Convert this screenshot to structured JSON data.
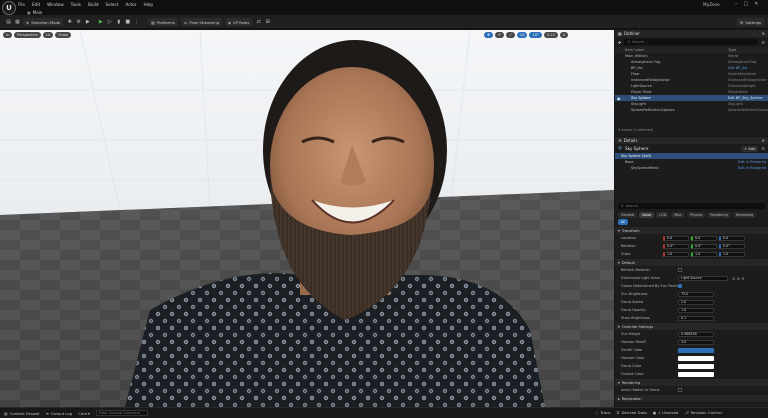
{
  "app": {
    "logo": "U",
    "project_tab": "Main",
    "window_title": "MyZone"
  },
  "menu": [
    "File",
    "Edit",
    "Window",
    "Tools",
    "Build",
    "Select",
    "Actor",
    "Help"
  ],
  "toolbar": {
    "save_icon": "save-icon",
    "mode_label": "Selection Mode",
    "platforms_label": "Platforms",
    "pixel_streaming_label": "Pixel Streaming",
    "vp_rules_label": "VP Roles",
    "settings_label": "Settings"
  },
  "viewport": {
    "perspective_label": "Perspective",
    "lit_label": "Lit",
    "show_label": "Show",
    "snap_value_1": "10",
    "snap_value_2": "10°",
    "snap_value_3": "0.25",
    "camera_speed": "4"
  },
  "outliner": {
    "title": "Outliner",
    "search_placeholder": "Search...",
    "col_label": "Item Label",
    "col_type": "Type",
    "rows": [
      {
        "name": "Main (Editor)",
        "type": "World"
      },
      {
        "name": "Atmospheric Fog",
        "type": "AtmosphericFog"
      },
      {
        "name": "BP_Avi",
        "type": "Edit BP_Avi"
      },
      {
        "name": "Floor",
        "type": "StaticMeshActor"
      },
      {
        "name": "InstancedFoliageActor",
        "type": "InstancedFoliageActor"
      },
      {
        "name": "LightSource",
        "type": "DirectionalLight"
      },
      {
        "name": "Player Start",
        "type": "PlayerStart"
      },
      {
        "name": "Sky Sphere",
        "type": "Edit BP_Sky_Sphere"
      },
      {
        "name": "SkyLight",
        "type": "SkyLight"
      },
      {
        "name": "SphereReflectionCapture",
        "type": "SphereReflectionCapture"
      }
    ],
    "count_text": "9 actors (1 selected)"
  },
  "details": {
    "title": "Details",
    "actor_name": "Sky Sphere",
    "add_label": "+ Add",
    "components": [
      {
        "name": "Sky Sphere (Self)",
        "link": ""
      },
      {
        "name": "Base",
        "link": "Edit in Blueprint"
      },
      {
        "name": "SkySphereMesh",
        "link": "Edit in Blueprint"
      }
    ],
    "search_placeholder": "Search",
    "tabs": [
      "General",
      "Actor",
      "LOD",
      "Misc",
      "Physics",
      "Rendering",
      "Streaming",
      "All"
    ],
    "transform": {
      "title": "Transform",
      "rows": [
        {
          "label": "Location",
          "x": "0.0",
          "y": "0.0",
          "z": "0.0"
        },
        {
          "label": "Rotation",
          "x": "0.0°",
          "y": "0.0°",
          "z": "0.0°"
        },
        {
          "label": "Scale",
          "x": "1.0",
          "y": "1.0",
          "z": "1.0"
        }
      ]
    },
    "default": {
      "title": "Default",
      "props": [
        {
          "label": "Refresh Material",
          "kind": "check",
          "value": ""
        },
        {
          "label": "Directional Light Actor",
          "kind": "select",
          "value": "Light Source"
        },
        {
          "label": "Colors Determined By Sun Position",
          "kind": "check",
          "value": ""
        },
        {
          "label": "Sun Brightness",
          "kind": "field",
          "value": "75.0"
        },
        {
          "label": "Cloud Speed",
          "kind": "field",
          "value": "2.0"
        },
        {
          "label": "Cloud Opacity",
          "kind": "field",
          "value": "1.0"
        },
        {
          "label": "Stars Brightness",
          "kind": "field",
          "value": "0.1"
        }
      ]
    },
    "override": {
      "title": "Override Settings",
      "props": [
        {
          "label": "Sun Height",
          "kind": "field",
          "value": "0.968556"
        },
        {
          "label": "Horizon Falloff",
          "kind": "field",
          "value": "3.0"
        },
        {
          "label": "Zenith Color",
          "kind": "color",
          "value": "#2f6fb8"
        },
        {
          "label": "Horizon Color",
          "kind": "color",
          "value": "#ffffff"
        },
        {
          "label": "Cloud Color",
          "kind": "color",
          "value": "#ffffff"
        },
        {
          "label": "Overall Color",
          "kind": "color",
          "value": "#ffffff"
        }
      ]
    },
    "rendering": {
      "title": "Rendering",
      "props": [
        {
          "label": "Actor Hidden In Game",
          "kind": "check",
          "value": ""
        }
      ]
    },
    "replication": {
      "title": "Replication"
    }
  },
  "statusbar": {
    "content_drawer": "Content Drawer",
    "output_log": "Output Log",
    "cmd": "Cmd",
    "console_placeholder": "Enter Console Command",
    "trace": "Trace",
    "derived_data": "Derived Data",
    "unsaved": "1 Unsaved",
    "revision_control": "Revision Control"
  }
}
